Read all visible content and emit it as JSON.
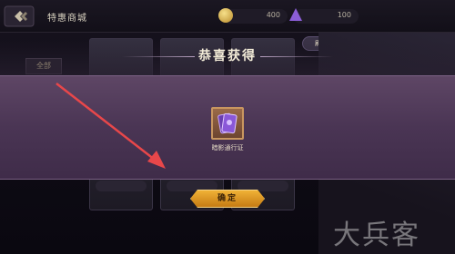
{
  "header": {
    "title": "特惠商城",
    "coins": "400",
    "gems": "100"
  },
  "sidebar": {
    "tab_all": "全部"
  },
  "right_button": "刷新",
  "modal": {
    "title": "恭喜获得",
    "item_name": "暗影通行证",
    "confirm_label": "确定"
  },
  "watermark": "大兵客",
  "colors": {
    "accent": "#e9a22a",
    "modal_bg": "#4a3554",
    "arrow": "#e8474a"
  }
}
